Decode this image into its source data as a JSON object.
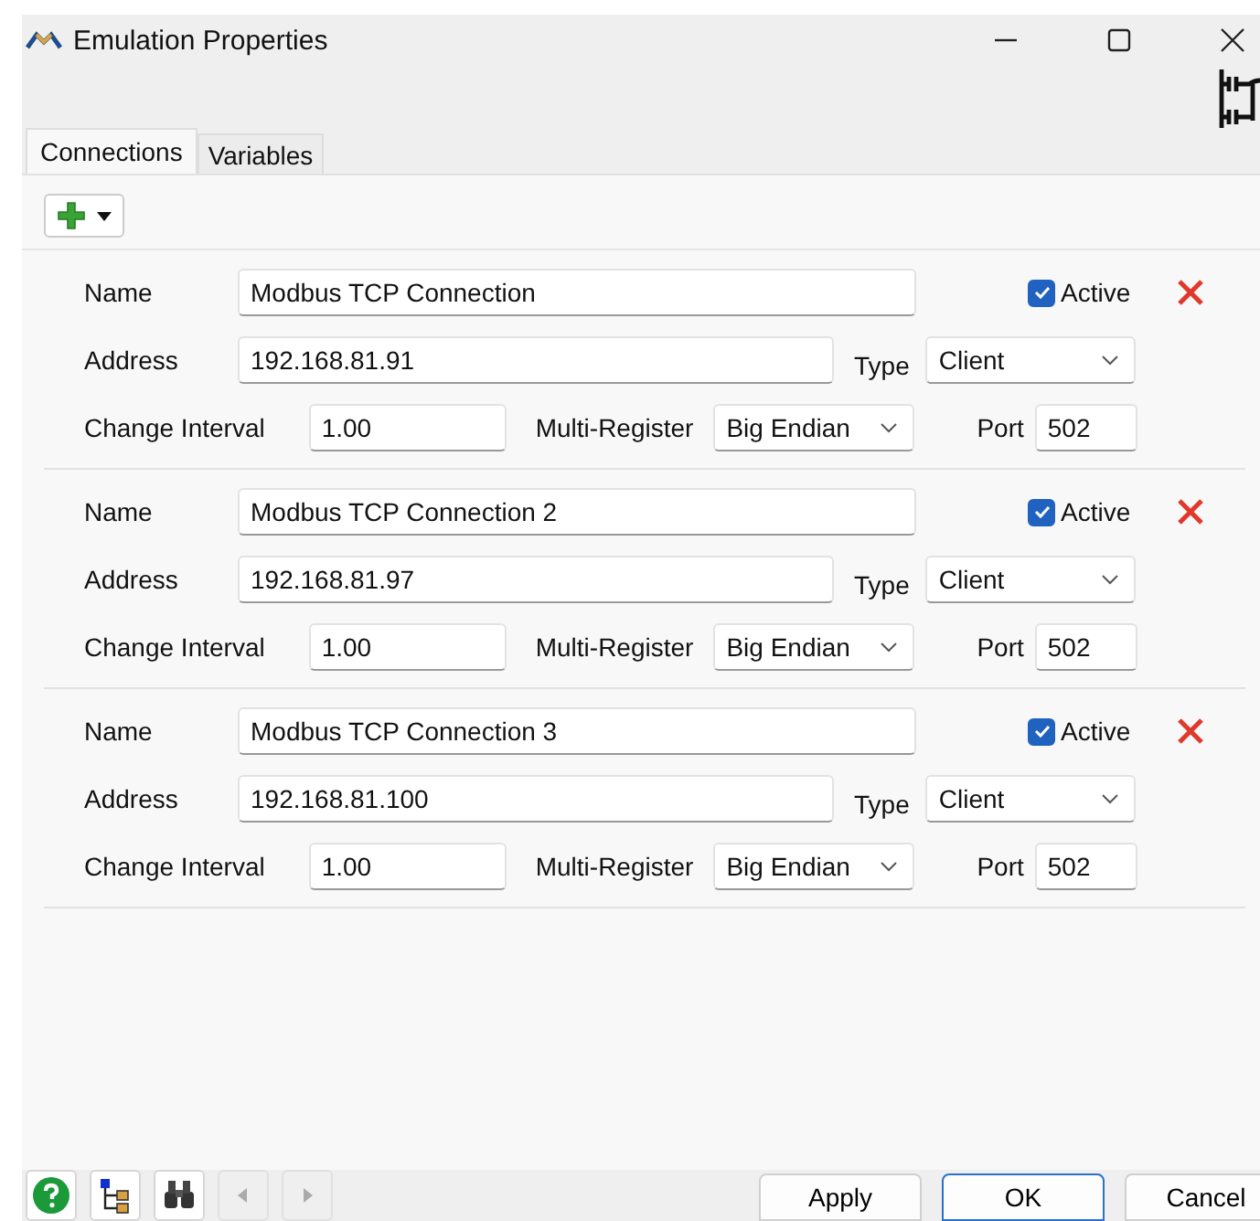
{
  "window": {
    "title": "Emulation Properties"
  },
  "tabs": [
    {
      "label": "Connections",
      "selected": true
    },
    {
      "label": "Variables",
      "selected": false
    }
  ],
  "connections": [
    {
      "name_label": "Name",
      "name": "Modbus TCP Connection",
      "active_label": "Active",
      "active": true,
      "address_label": "Address",
      "address": "192.168.81.91",
      "type_label": "Type",
      "type": "Client",
      "interval_label": "Change Interval",
      "interval": "1.00",
      "multi_label": "Multi-Register",
      "multi": "Big Endian",
      "port_label": "Port",
      "port": "502"
    },
    {
      "name_label": "Name",
      "name": "Modbus TCP Connection 2",
      "active_label": "Active",
      "active": true,
      "address_label": "Address",
      "address": "192.168.81.97",
      "type_label": "Type",
      "type": "Client",
      "interval_label": "Change Interval",
      "interval": "1.00",
      "multi_label": "Multi-Register",
      "multi": "Big Endian",
      "port_label": "Port",
      "port": "502"
    },
    {
      "name_label": "Name",
      "name": "Modbus TCP Connection 3",
      "active_label": "Active",
      "active": true,
      "address_label": "Address",
      "address": "192.168.81.100",
      "type_label": "Type",
      "type": "Client",
      "interval_label": "Change Interval",
      "interval": "1.00",
      "multi_label": "Multi-Register",
      "multi": "Big Endian",
      "port_label": "Port",
      "port": "502"
    }
  ],
  "buttons": [
    {
      "label": "Apply",
      "default": false
    },
    {
      "label": "OK",
      "default": true
    },
    {
      "label": "Cancel",
      "default": false
    }
  ]
}
